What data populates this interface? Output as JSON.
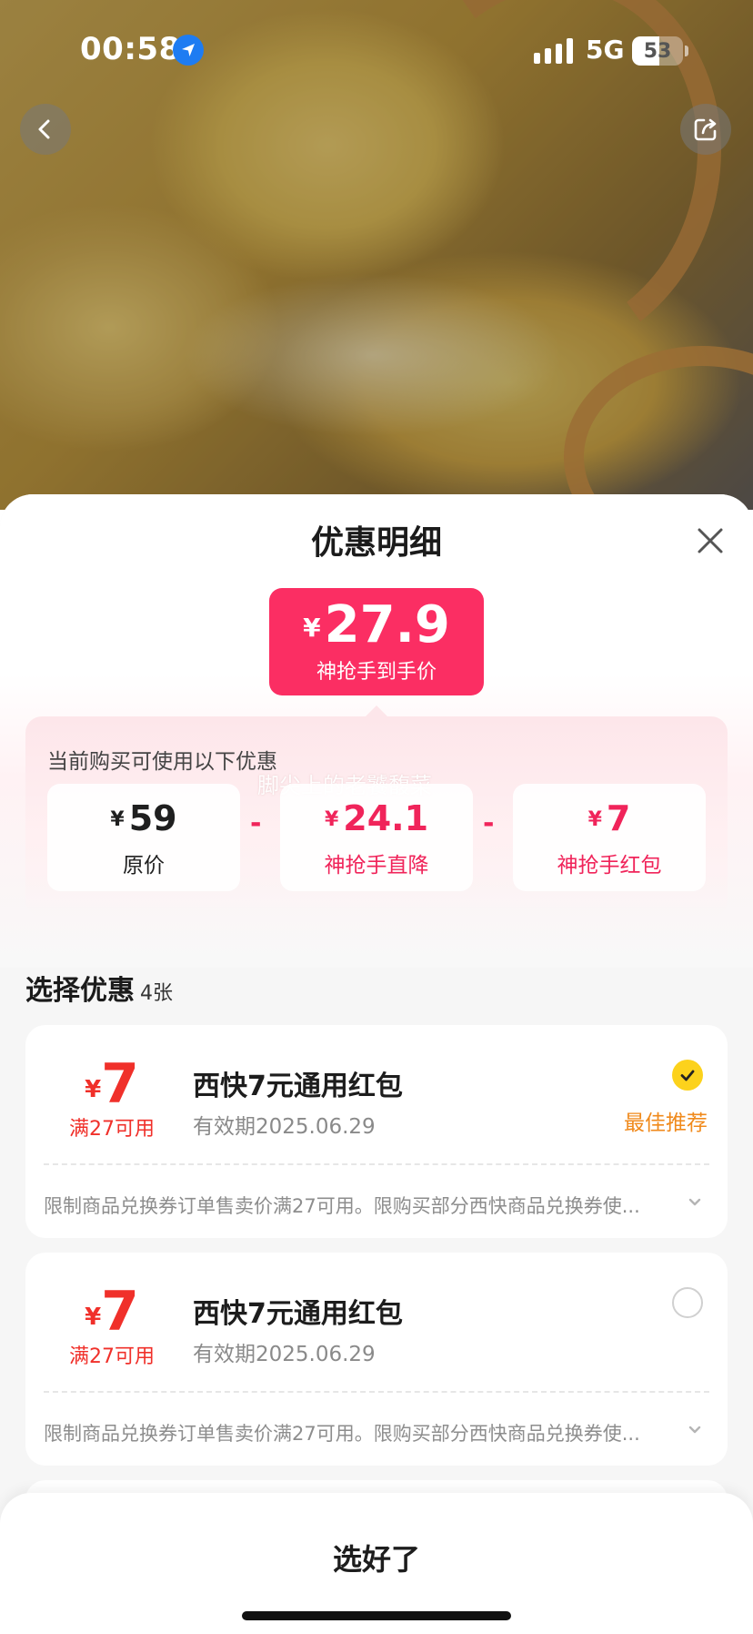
{
  "status_bar": {
    "time": "00:58",
    "network": "5G",
    "battery": "53",
    "battery_level": 0.53
  },
  "sheet": {
    "title": "优惠明细"
  },
  "final_price": {
    "currency": "¥",
    "amount": "27.9",
    "caption": "神抢手到手价"
  },
  "breakdown": {
    "title": "当前购买可使用以下优惠",
    "watermark": "脚尖上的老饕馥菜",
    "items": [
      {
        "currency": "¥",
        "value": "59",
        "label": "原价"
      },
      {
        "currency": "¥",
        "value": "24.1",
        "label": "神抢手直降"
      },
      {
        "currency": "¥",
        "value": "7",
        "label": "神抢手红包"
      }
    ],
    "operators": [
      "-",
      "-"
    ]
  },
  "section": {
    "title": "选择优惠",
    "count": "4张"
  },
  "coupons": [
    {
      "currency": "¥",
      "value": "7",
      "condition": "满27可用",
      "title": "西快7元通用红包",
      "expiry": "有效期2025.06.29",
      "selected": true,
      "tag": "最佳推荐",
      "description": "限制商品兑换券订单售卖价满27可用。限购买部分西快商品兑换券使..."
    },
    {
      "currency": "¥",
      "value": "7",
      "condition": "满27可用",
      "title": "西快7元通用红包",
      "expiry": "有效期2025.06.29",
      "selected": false,
      "tag": "",
      "description": "限制商品兑换券订单售卖价满27可用。限购买部分西快商品兑换券使..."
    }
  ],
  "footer": {
    "confirm_label": "选好了"
  },
  "colors": {
    "accent": "#fb2e63",
    "coupon_red": "#f0302a",
    "best_orange": "#f08a1c",
    "check_yellow": "#fcd21c"
  },
  "icons": [
    "location-arrow-icon",
    "signal-icon",
    "battery-icon",
    "back-icon",
    "share-icon",
    "close-icon",
    "checkmark-icon",
    "chevron-down-icon"
  ]
}
